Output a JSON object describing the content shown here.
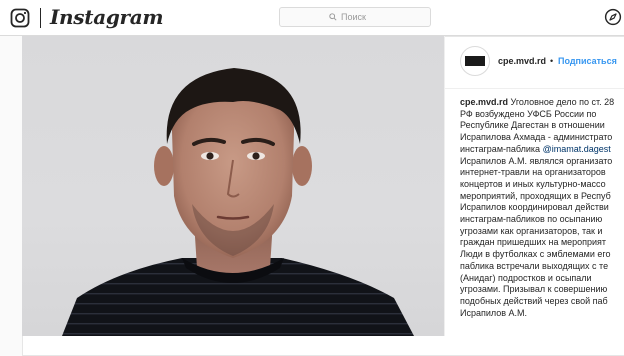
{
  "header": {
    "app_name": "Instagram",
    "search_placeholder": "Поиск"
  },
  "post": {
    "username": "cpe.mvd.rd",
    "separator": "•",
    "follow_label": "Подписаться",
    "avatar_text": [
      "ЗАЩИТАТЬ",
      "ПРАВА"
    ],
    "caption": {
      "user": "cpe.mvd.rd",
      "first_line_text": " Уголовное дело по ст. 28",
      "mention": "@imamat.dagest",
      "lines": [
        "РФ возбуждено УФСБ России по",
        "Республике Дагестан в отношении",
        "Исрапилова Ахмада - администрато",
        "инстаграм-паблика ",
        "Исрапилов А.М. являлся организато",
        "интернет-травли на организаторов",
        "концертов и иных культурно-массо",
        "мероприятий, проходящих в Респуб",
        "Исрапилов координировал действи",
        "инстаграм-пабликов по осыпанию",
        "угрозами как организаторов, так и",
        "граждан пришедших на мероприят",
        "Люди в футболках с эмблемами его",
        "паблика встречали выходящих с те",
        "(Анидаг) подростков и осыпали",
        "угрозами. Призывал к совершению",
        "подобных действий через свой паб",
        "Исрапилов А.М."
      ]
    }
  },
  "colors": {
    "link": "#3897f0",
    "mention": "#003569",
    "text": "#262626",
    "border": "#dbdbdb"
  },
  "icons": [
    "instagram-camera-icon",
    "search-icon",
    "compass-icon"
  ]
}
